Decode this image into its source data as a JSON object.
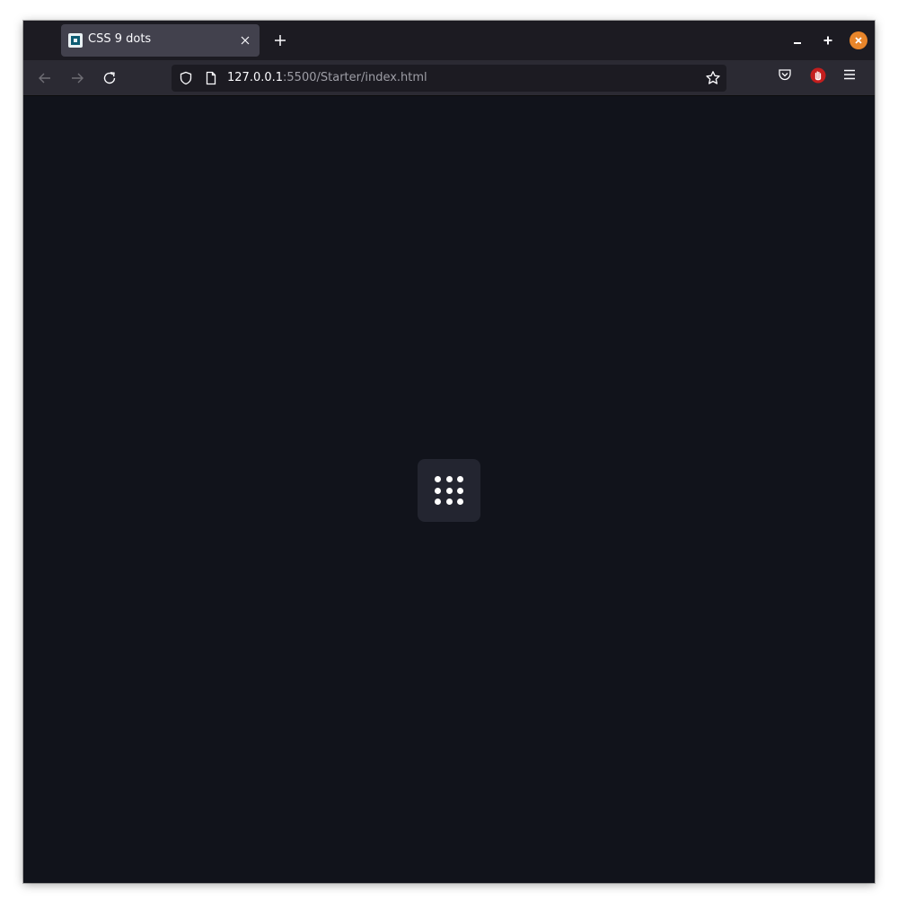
{
  "tab": {
    "title": "CSS 9 dots",
    "favicon": "vscode-live-server-favicon"
  },
  "window_controls": {
    "minimize_icon": "minimize-icon",
    "maximize_icon": "maximize-icon",
    "close_icon": "close-icon",
    "close_color": "#e8852a"
  },
  "navigation": {
    "back_icon": "arrow-left-icon",
    "forward_icon": "arrow-right-icon",
    "reload_icon": "reload-icon"
  },
  "urlbar": {
    "host": "127.0.0.1",
    "rest": ":5500/Starter/index.html"
  },
  "toolbar": {
    "pocket_icon": "pocket-icon",
    "ublock_icon": "ublock-origin-icon",
    "menu_icon": "hamburger-menu-icon"
  },
  "page": {
    "background": "#11131b",
    "button_background": "#232530",
    "dot_color": "#ffffff",
    "dots_count": 9,
    "icon": "nine-dots-grid-icon"
  }
}
